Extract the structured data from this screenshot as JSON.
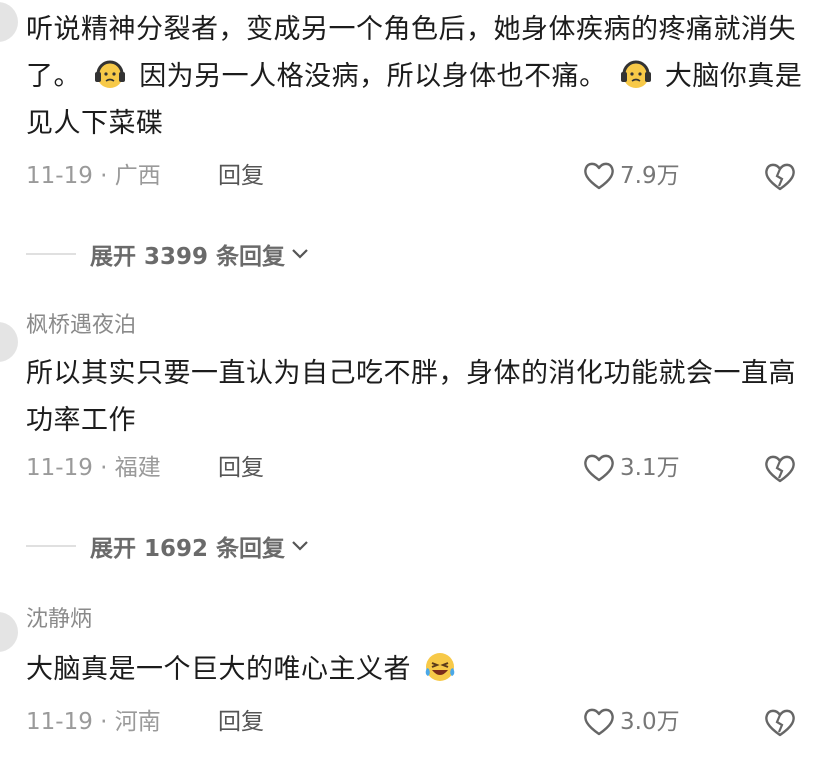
{
  "comments": [
    {
      "author": "",
      "text_parts": [
        "听说精神分裂者，变成另一个角色后，她身体疾病的疼痛就消失了。",
        "因为另一人格没病，所以身体也不痛。",
        "大脑你真是见人下菜碟"
      ],
      "emojis": [
        "worried-headphones-emoji",
        "worried-headphones-emoji"
      ],
      "date": "11-19 · 广西",
      "reply_label": "回复",
      "likes": "7.9万",
      "replies_expand": "展开 3399 条回复"
    },
    {
      "author": "枫桥遇夜泊",
      "text": "所以其实只要一直认为自己吃不胖，身体的消化功能就会一直高功率工作",
      "date": "11-19 · 福建",
      "reply_label": "回复",
      "likes": "3.1万",
      "replies_expand": "展开 1692 条回复"
    },
    {
      "author": "沈静炳",
      "text": "大脑真是一个巨大的唯心主义者",
      "emoji": "laughing-tears-emoji",
      "date": "11-19 · 河南",
      "reply_label": "回复",
      "likes": "3.0万"
    }
  ],
  "icons": {
    "like": "heart-outline-icon",
    "dislike": "broken-heart-icon",
    "expand": "chevron-down-icon"
  },
  "colors": {
    "emoji_face": "#f7c948",
    "headphone": "#333333",
    "meta_text": "#9a9a9a"
  }
}
